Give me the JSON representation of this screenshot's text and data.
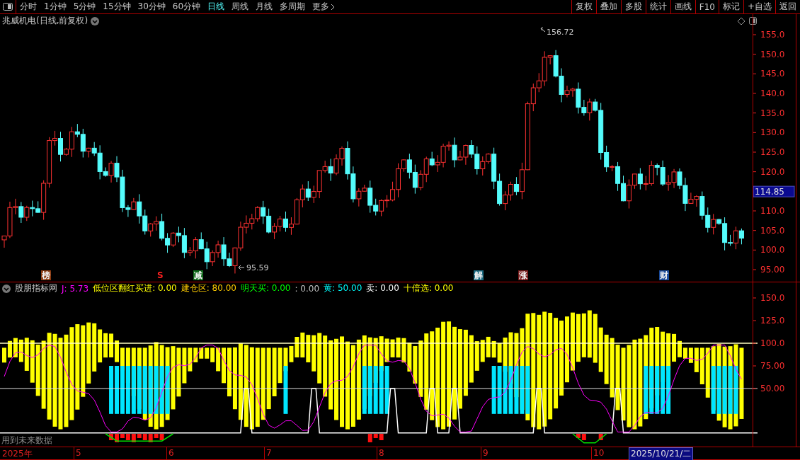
{
  "toolbar": {
    "periods": [
      {
        "label": "分时",
        "selected": false
      },
      {
        "label": "1分钟",
        "selected": false
      },
      {
        "label": "5分钟",
        "selected": false
      },
      {
        "label": "15分钟",
        "selected": false
      },
      {
        "label": "30分钟",
        "selected": false
      },
      {
        "label": "60分钟",
        "selected": false
      },
      {
        "label": "日线",
        "selected": true
      },
      {
        "label": "周线",
        "selected": false
      },
      {
        "label": "月线",
        "selected": false
      },
      {
        "label": "多周期",
        "selected": false
      },
      {
        "label": "更多",
        "selected": false
      }
    ],
    "actions": [
      "复权",
      "叠加",
      "多股",
      "统计",
      "画线",
      "F10",
      "标记",
      "+自选",
      "返回"
    ]
  },
  "main_chart": {
    "title": "兆威机电(日线,前复权)",
    "high_label": "156.72",
    "low_label": "95.59",
    "last_price": "114.85",
    "y_axis": [
      "155.0",
      "150.0",
      "145.0",
      "140.0",
      "135.0",
      "130.0",
      "125.0",
      "120.0",
      "110.0",
      "105.0",
      "100.0",
      "95.00"
    ],
    "events": [
      {
        "label": "榜",
        "kind": "tag",
        "color": "#8b3a10"
      },
      {
        "label": "S",
        "kind": "mark",
        "color": "#ff2020"
      },
      {
        "label": "减",
        "kind": "tag",
        "color": "#0f6a1a"
      },
      {
        "label": "解",
        "kind": "tag",
        "color": "#1a6a80"
      },
      {
        "label": "涨",
        "kind": "tag",
        "color": "#7a1a1a"
      },
      {
        "label": "财",
        "kind": "tag",
        "color": "#1a4a9a"
      }
    ]
  },
  "indicator": {
    "name": "股朋指标网",
    "values": [
      {
        "label": "J: 5.73",
        "color": "#ff00ff"
      },
      {
        "label": "低位区翻红买进: 0.00",
        "color": "#ffff00"
      },
      {
        "label": "建仓区: 80.00",
        "color": "#ffcc00"
      },
      {
        "label": "明天买: 0.00",
        "color": "#00ff00"
      },
      {
        "label": ": 0.00",
        "color": "#c0c0c0"
      },
      {
        "label": "黄: 50.00",
        "color": "#00ffff"
      },
      {
        "label": "卖: 0.00",
        "color": "#ffffff"
      },
      {
        "label": "十倍选: 0.00",
        "color": "#ffff00"
      }
    ],
    "y_axis": [
      "150.0",
      "125.0",
      "100.0",
      "75.00",
      "50.00"
    ],
    "note": "用到未来数据"
  },
  "time_axis": {
    "labels": [
      "2025年",
      "5",
      "6",
      "7",
      "8",
      "9",
      "10"
    ],
    "cursor_date": "2025/10/21/二"
  }
}
